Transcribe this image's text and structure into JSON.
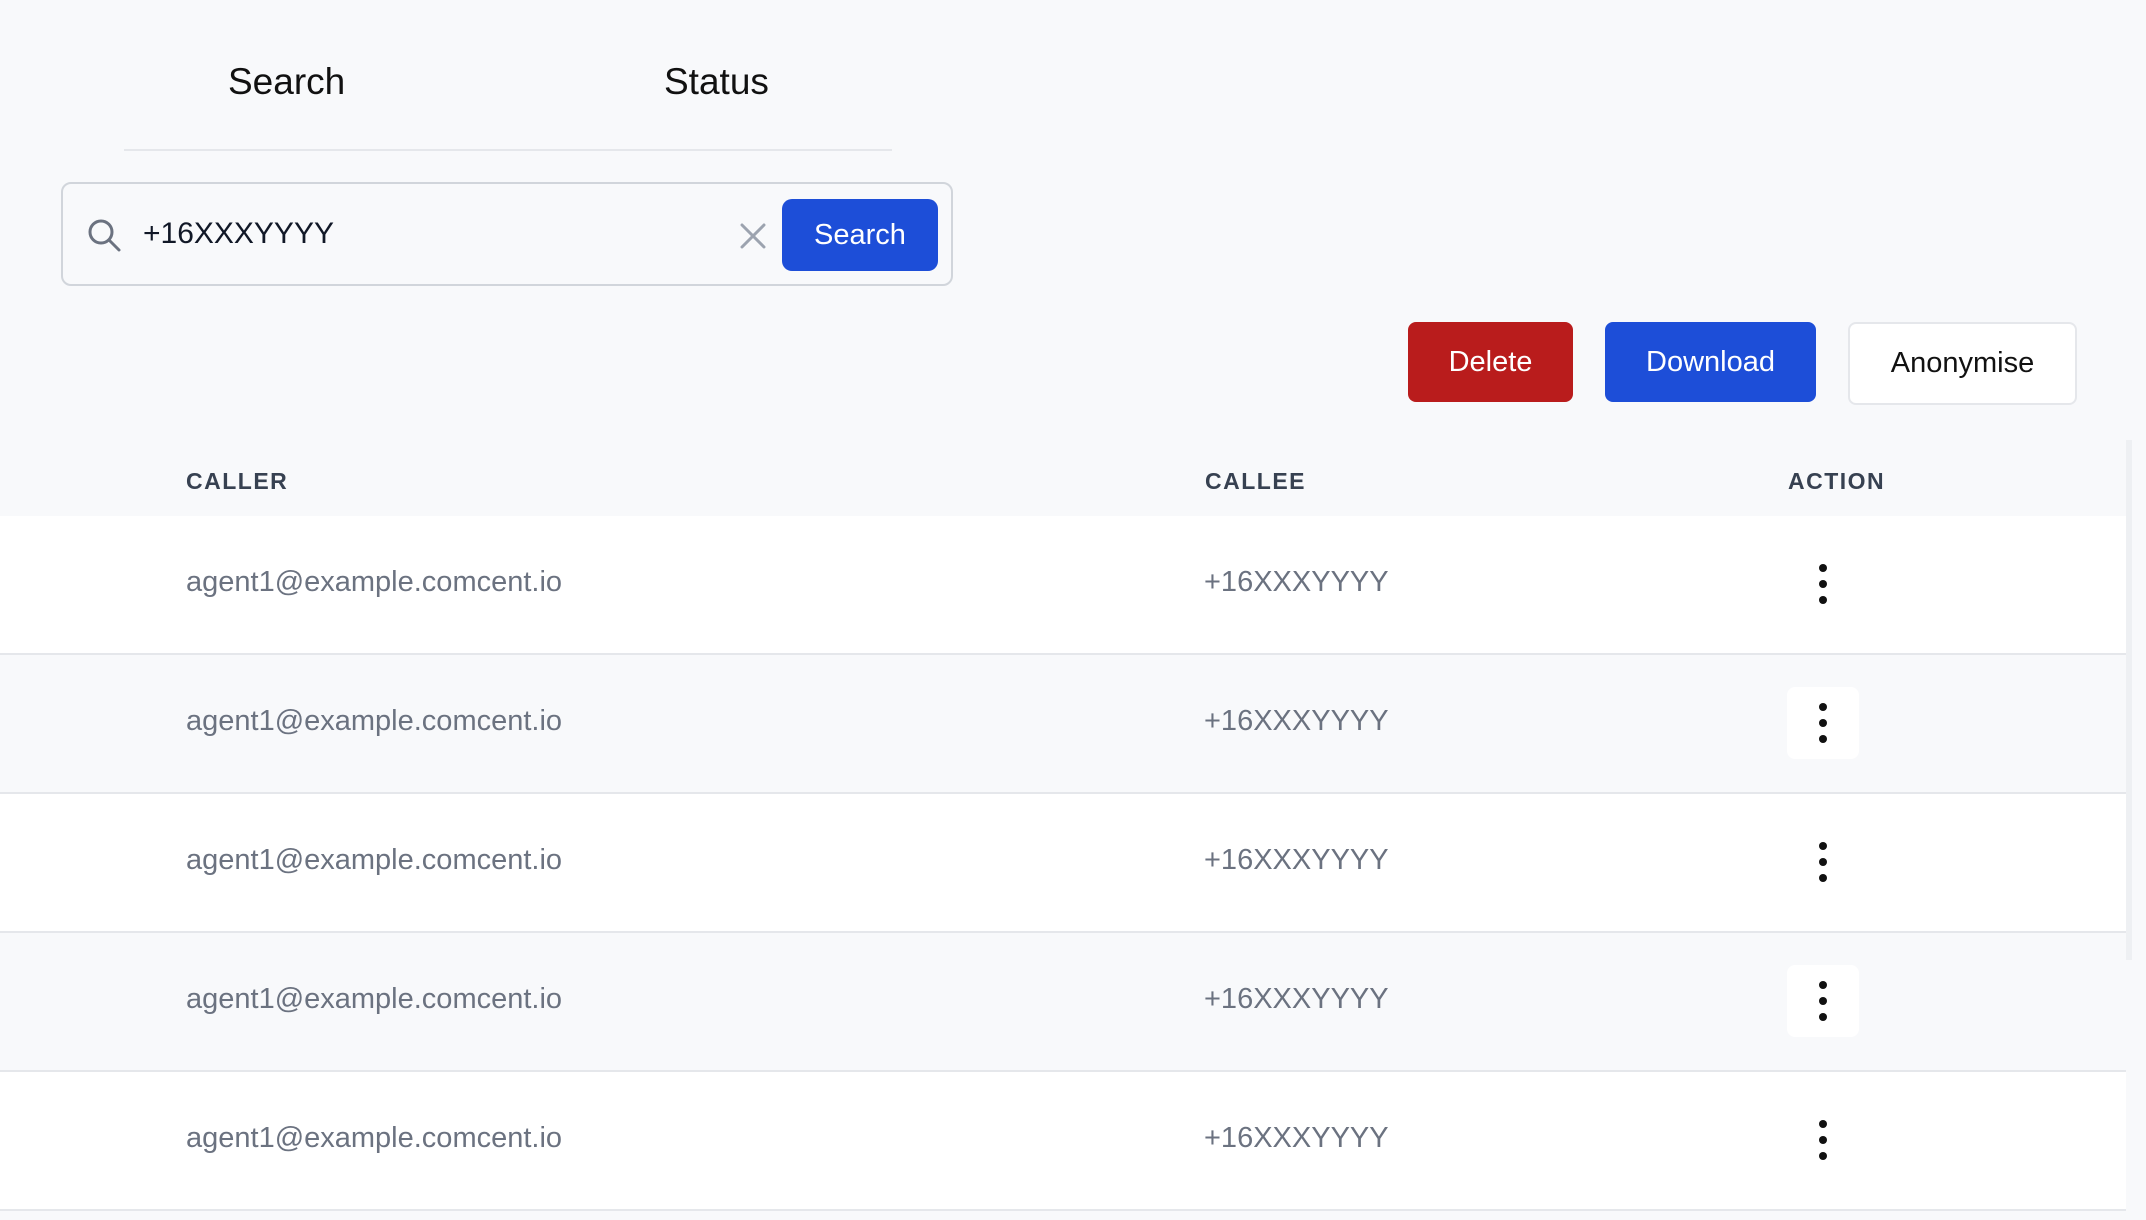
{
  "tabs": [
    {
      "label": "Search"
    },
    {
      "label": "Status"
    }
  ],
  "search": {
    "value": "+16XXXYYYY",
    "button_label": "Search"
  },
  "actions": {
    "delete_label": "Delete",
    "download_label": "Download",
    "anonymise_label": "Anonymise"
  },
  "table": {
    "headers": {
      "caller": "CALLER",
      "callee": "CALLEE",
      "action": "ACTION"
    },
    "rows": [
      {
        "caller": "agent1@example.comcent.io",
        "callee": "+16XXXYYYY"
      },
      {
        "caller": "agent1@example.comcent.io",
        "callee": "+16XXXYYYY"
      },
      {
        "caller": "agent1@example.comcent.io",
        "callee": "+16XXXYYYY"
      },
      {
        "caller": "agent1@example.comcent.io",
        "callee": "+16XXXYYYY"
      },
      {
        "caller": "agent1@example.comcent.io",
        "callee": "+16XXXYYYY"
      }
    ]
  },
  "icons": {
    "search": "search-icon",
    "clear": "close-icon",
    "row_action": "kebab-menu-icon"
  },
  "colors": {
    "primary": "#1d4ed8",
    "danger": "#b91c1c",
    "background": "#f8f9fb"
  }
}
